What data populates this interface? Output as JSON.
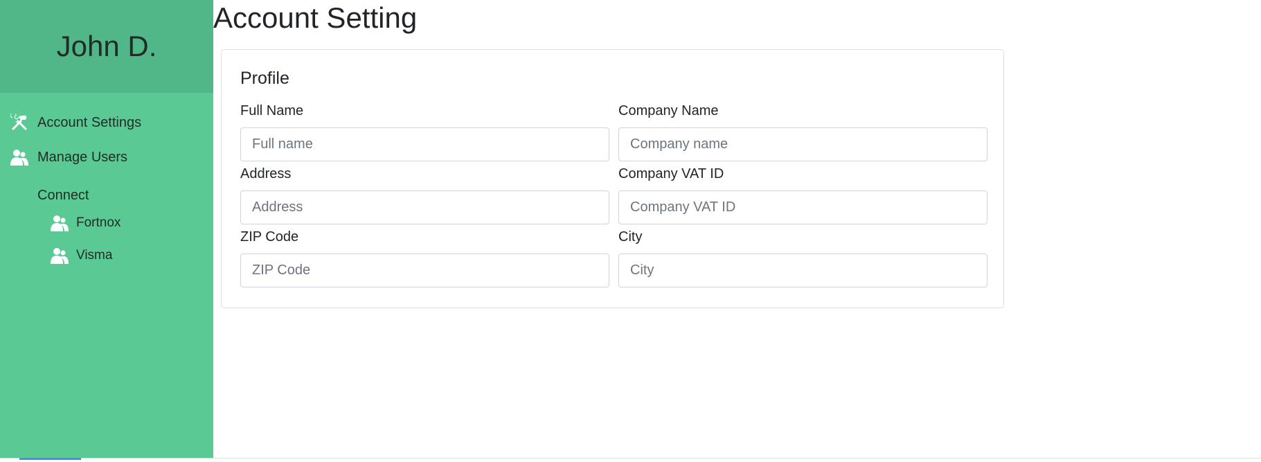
{
  "sidebar": {
    "user_name": "John D.",
    "nav": [
      {
        "label": "Account Settings",
        "icon": "tools-icon"
      },
      {
        "label": "Manage Users",
        "icon": "users-icon"
      }
    ],
    "connect": {
      "title": "Connect",
      "items": [
        {
          "label": "Fortnox",
          "icon": "users-icon"
        },
        {
          "label": "Visma",
          "icon": "users-icon"
        }
      ]
    }
  },
  "main": {
    "title": "Account Setting",
    "profile": {
      "title": "Profile",
      "fields": {
        "full_name": {
          "label": "Full Name",
          "placeholder": "Full name",
          "value": ""
        },
        "company_name": {
          "label": "Company Name",
          "placeholder": "Company name",
          "value": ""
        },
        "address": {
          "label": "Address",
          "placeholder": "Address",
          "value": ""
        },
        "company_vat_id": {
          "label": "Company VAT ID",
          "placeholder": "Company VAT ID",
          "value": ""
        },
        "zip_code": {
          "label": "ZIP Code",
          "placeholder": "ZIP Code",
          "value": ""
        },
        "city": {
          "label": "City",
          "placeholder": "City",
          "value": ""
        }
      }
    }
  },
  "colors": {
    "sidebar_bg": "#5ac994",
    "sidebar_header_bg": "#52b788",
    "accent": "#4a90e2"
  }
}
